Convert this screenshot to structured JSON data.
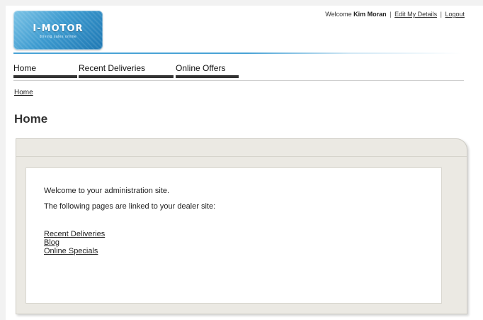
{
  "logo": {
    "name": "I-MOTOR",
    "tagline": "driving sales online"
  },
  "topbar": {
    "welcome": "Welcome",
    "user_name": "Kim Moran",
    "edit_details": "Edit My Details",
    "logout": "Logout",
    "separator": "|"
  },
  "nav": {
    "items": [
      {
        "label": "Home"
      },
      {
        "label": "Recent Deliveries"
      },
      {
        "label": "Online Offers"
      }
    ]
  },
  "breadcrumb": {
    "home": "Home"
  },
  "page": {
    "title": "Home"
  },
  "content": {
    "welcome": "Welcome to your administration site.",
    "linked_pages": "The following pages are linked to your dealer site:",
    "links": [
      {
        "label": "Recent Deliveries"
      },
      {
        "label": "Blog"
      },
      {
        "label": "Online Specials"
      }
    ]
  },
  "colors": {
    "accent": "#4aa3d6",
    "nav_bar": "#333333",
    "panel_bg": "#ebe9e3"
  }
}
